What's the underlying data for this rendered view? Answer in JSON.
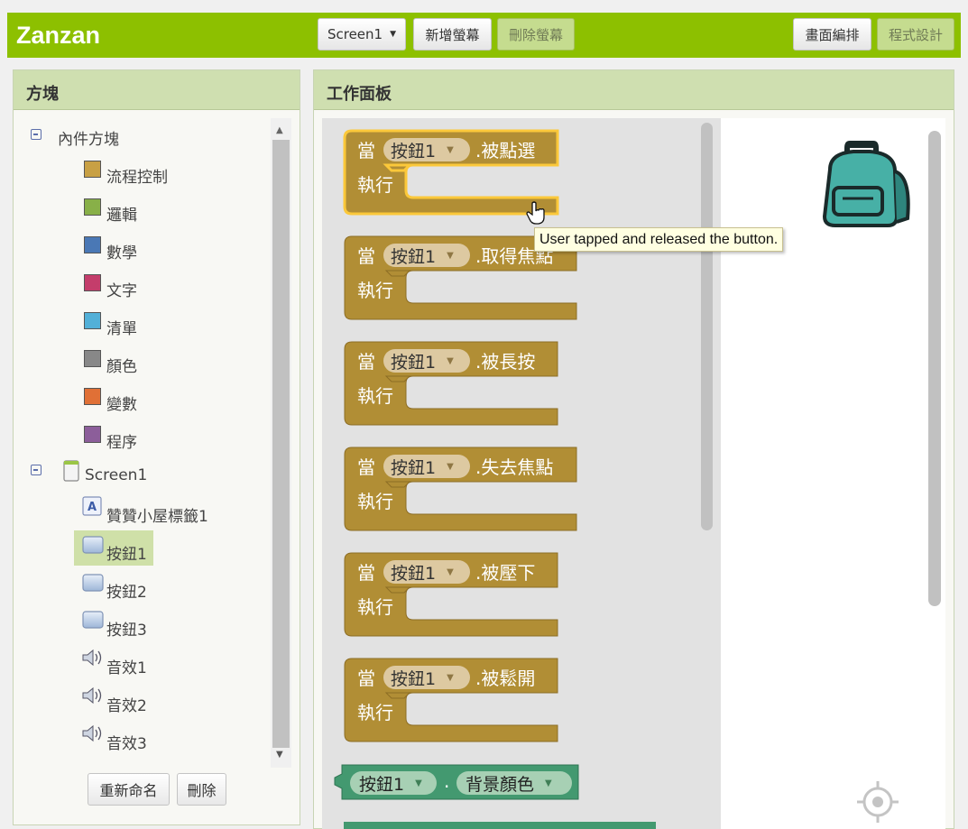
{
  "app": {
    "name": "Zanzan",
    "screen_select": "Screen1",
    "add_screen": "新增螢幕",
    "remove_screen": "刪除螢幕",
    "designer": "畫面編排",
    "blocks": "程式設計"
  },
  "blocks_panel": {
    "title": "方塊",
    "builtin": {
      "label": "內件方塊",
      "items": [
        {
          "label": "流程控制",
          "color": "#c8a044"
        },
        {
          "label": "邏輯",
          "color": "#88b048"
        },
        {
          "label": "數學",
          "color": "#4a78b5"
        },
        {
          "label": "文字",
          "color": "#c43d6b"
        },
        {
          "label": "清單",
          "color": "#52b0d8"
        },
        {
          "label": "顏色",
          "color": "#888888"
        },
        {
          "label": "變數",
          "color": "#e07036"
        },
        {
          "label": "程序",
          "color": "#8c5e9a"
        }
      ]
    },
    "screen": {
      "label": "Screen1",
      "components": [
        {
          "label": "贊贊小屋標籤1",
          "icon": "label-icon"
        },
        {
          "label": "按鈕1",
          "icon": "button-icon",
          "selected": true
        },
        {
          "label": "按鈕2",
          "icon": "button-icon"
        },
        {
          "label": "按鈕3",
          "icon": "button-icon"
        },
        {
          "label": "音效1",
          "icon": "sound-icon"
        },
        {
          "label": "音效2",
          "icon": "sound-icon"
        },
        {
          "label": "音效3",
          "icon": "sound-icon"
        }
      ]
    },
    "rename": "重新命名",
    "delete": "刪除"
  },
  "workspace": {
    "title": "工作面板",
    "when": "當",
    "do": "執行",
    "component": "按鈕1",
    "events": [
      ".被點選",
      ".取得焦點",
      ".被長按",
      ".失去焦點",
      ".被壓下",
      ".被鬆開"
    ],
    "getter": {
      "component": "按鈕1",
      "dot": ".",
      "property": "背景顏色"
    },
    "tooltip": "User tapped and released the button.",
    "event_color": "#b18e35",
    "getter_color": "#439970"
  }
}
